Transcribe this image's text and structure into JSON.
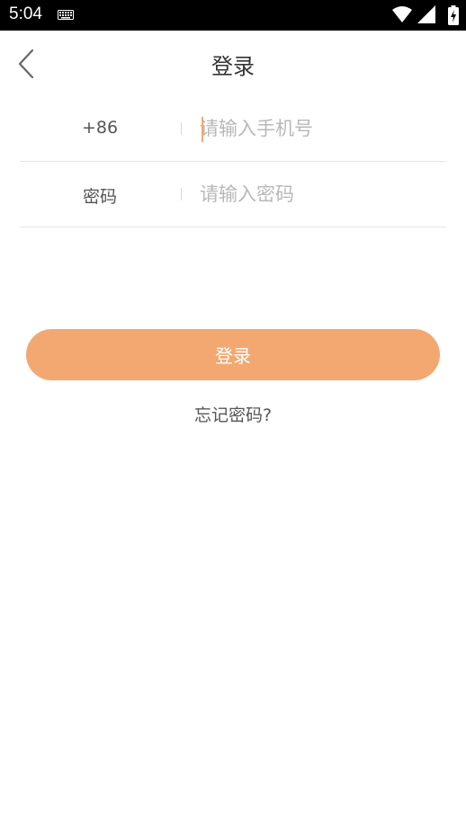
{
  "status_bar": {
    "time": "5:04",
    "icons": [
      "keyboard-icon",
      "wifi-icon",
      "cellular-signal-icon",
      "battery-charging-icon"
    ]
  },
  "header": {
    "title": "登录",
    "back_icon": "chevron-left-icon"
  },
  "form": {
    "phone": {
      "prefix": "+86",
      "value": "",
      "placeholder": "请输入手机号"
    },
    "password": {
      "label": "密码",
      "value": "",
      "placeholder": "请输入密码"
    }
  },
  "actions": {
    "login_label": "登录",
    "forgot_label": "忘记密码?"
  },
  "colors": {
    "accent": "#f2a870",
    "text": "#333333",
    "placeholder": "#b8b8b8",
    "divider": "#e6e6e6"
  }
}
